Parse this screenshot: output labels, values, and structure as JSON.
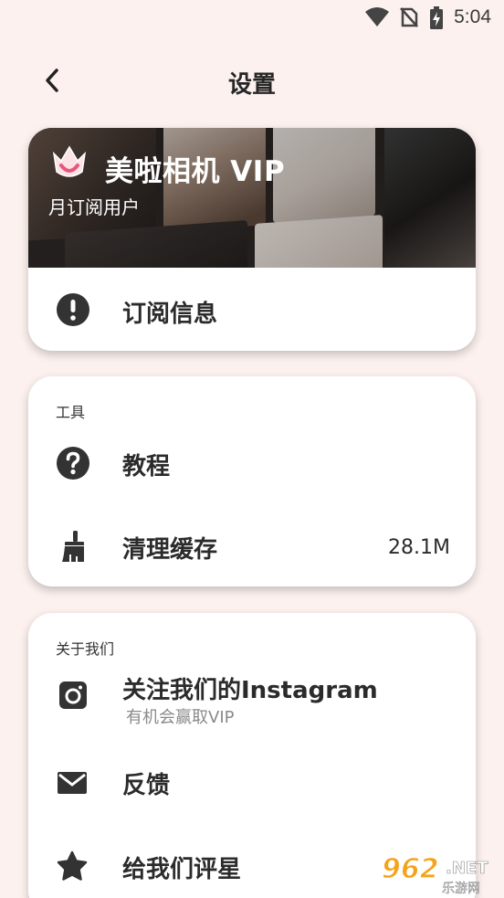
{
  "status_bar": {
    "time": "5:04",
    "icons": [
      "wifi-icon",
      "no-sim-icon",
      "battery-charging-icon"
    ]
  },
  "header": {
    "title": "设置",
    "back_icon": "chevron-left-icon"
  },
  "vip_card": {
    "title": "美啦相机 VIP",
    "subtitle": "月订阅用户",
    "logo_icon": "crown-logo-icon",
    "row": {
      "icon": "exclamation-circle-icon",
      "label": "订阅信息"
    }
  },
  "tools_card": {
    "section": "工具",
    "items": [
      {
        "icon": "question-circle-icon",
        "label": "教程"
      },
      {
        "icon": "broom-icon",
        "label": "清理缓存",
        "value": "28.1M"
      }
    ]
  },
  "about_card": {
    "section": "关于我们",
    "items": [
      {
        "icon": "instagram-icon",
        "label": "关注我们的Instagram",
        "sublabel": "有机会赢取VIP"
      },
      {
        "icon": "mail-icon",
        "label": "反馈"
      },
      {
        "icon": "star-icon",
        "label": "给我们评星"
      }
    ]
  },
  "watermark": {
    "text": "962",
    "suffix": ".NET",
    "caption": "乐游网"
  },
  "colors": {
    "background": "#fcf1ee",
    "card": "#ffffff",
    "icon": "#333333",
    "accent_logo": "#e8587b"
  }
}
